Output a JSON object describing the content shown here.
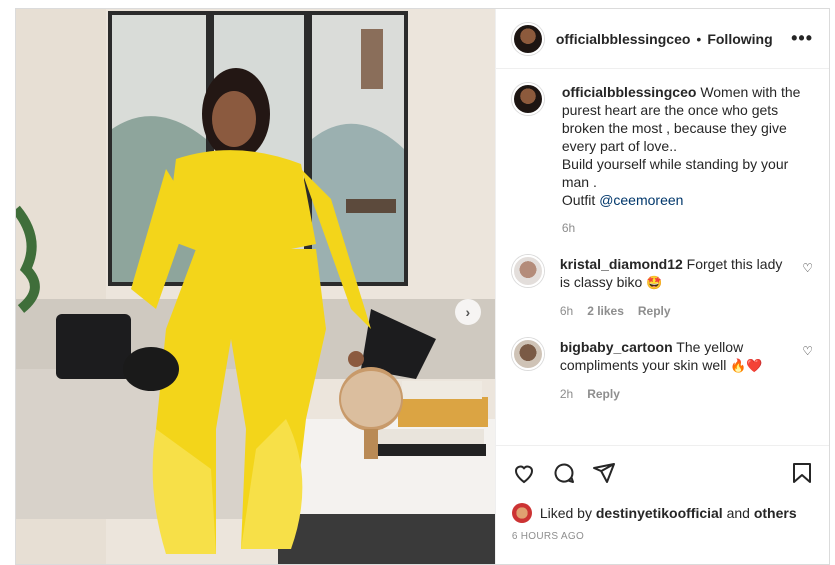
{
  "header": {
    "username": "officialbblessingceo",
    "separator": "•",
    "follow_status": "Following",
    "more": "•••"
  },
  "caption": {
    "username": "officialbblessingceo",
    "text_1": "Women with the purest heart are the once who gets broken the most , because they give every part of love..",
    "text_2": "Build yourself while standing by your man .",
    "text_3": "Outfit",
    "mention": "@ceemoreen",
    "time": "6h"
  },
  "comments": [
    {
      "username": "kristal_diamond12",
      "text": "Forget this lady is classy biko",
      "emoji": "🤩",
      "time": "6h",
      "likes": "2 likes",
      "reply": "Reply"
    },
    {
      "username": "bigbaby_cartoon",
      "text": "The yellow compliments your skin well",
      "emoji": "🔥❤️",
      "time": "2h",
      "reply": "Reply"
    }
  ],
  "likes": {
    "prefix": "Liked by",
    "user": "destinyetikoofficial",
    "and": "and",
    "others": "others"
  },
  "timestamp": "6 HOURS AGO",
  "colors": {
    "outfit_yellow": "#f3d51a",
    "border": "#dbdbdb",
    "muted": "#8e8e8e"
  }
}
